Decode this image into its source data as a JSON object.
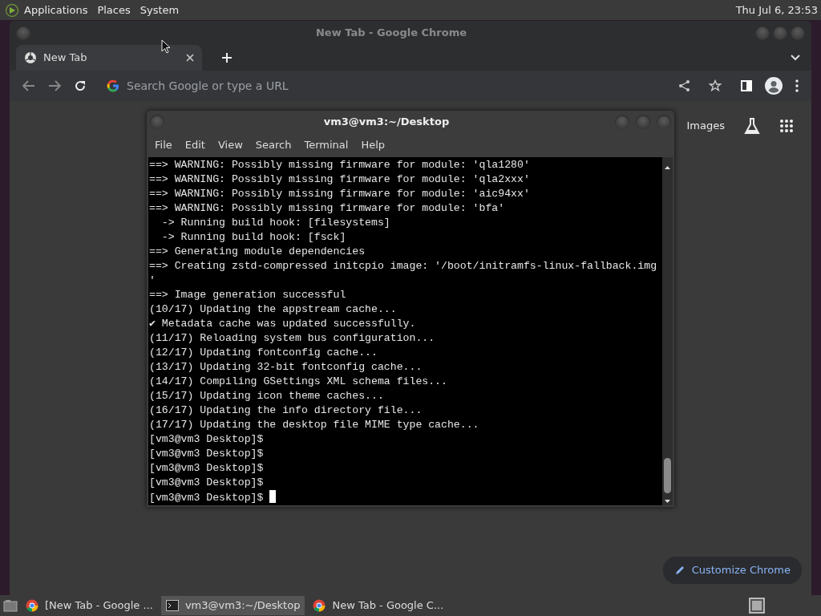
{
  "top_panel": {
    "menus": [
      "Applications",
      "Places",
      "System"
    ],
    "clock": "Thu Jul  6, 23:53"
  },
  "browser": {
    "title": "New Tab - Google Chrome",
    "tabs": [
      {
        "label": "New Tab",
        "selected": true
      }
    ],
    "address_bar": {
      "placeholder": "Search Google or type a URL"
    },
    "new_tab_page": {
      "links": [
        "Images"
      ],
      "customize_button": "Customize Chrome"
    }
  },
  "terminal": {
    "title": "vm3@vm3:~/Desktop",
    "menu": [
      "File",
      "Edit",
      "View",
      "Search",
      "Terminal",
      "Help"
    ],
    "lines": [
      "==> WARNING: Possibly missing firmware for module: 'qla1280'",
      "==> WARNING: Possibly missing firmware for module: 'qla2xxx'",
      "==> WARNING: Possibly missing firmware for module: 'aic94xx'",
      "==> WARNING: Possibly missing firmware for module: 'bfa'",
      "  -> Running build hook: [filesystems]",
      "  -> Running build hook: [fsck]",
      "==> Generating module dependencies",
      "==> Creating zstd-compressed initcpio image: '/boot/initramfs-linux-fallback.img",
      "'",
      "==> Image generation successful",
      "(10/17) Updating the appstream cache...",
      "✔ Metadata cache was updated successfully.",
      "(11/17) Reloading system bus configuration...",
      "(12/17) Updating fontconfig cache...",
      "(13/17) Updating 32-bit fontconfig cache...",
      "(14/17) Compiling GSettings XML schema files...",
      "(15/17) Updating icon theme caches...",
      "(16/17) Updating the info directory file...",
      "(17/17) Updating the desktop file MIME type cache...",
      "[vm3@vm3 Desktop]$",
      "[vm3@vm3 Desktop]$",
      "[vm3@vm3 Desktop]$",
      "[vm3@vm3 Desktop]$",
      "[vm3@vm3 Desktop]$ "
    ]
  },
  "taskbar": {
    "items": [
      {
        "label": "[New Tab - Google ...",
        "kind": "browser",
        "selected": false
      },
      {
        "label": "vm3@vm3:~/Desktop",
        "kind": "terminal",
        "selected": true
      },
      {
        "label": "New Tab - Google C...",
        "kind": "browser",
        "selected": false
      }
    ]
  }
}
